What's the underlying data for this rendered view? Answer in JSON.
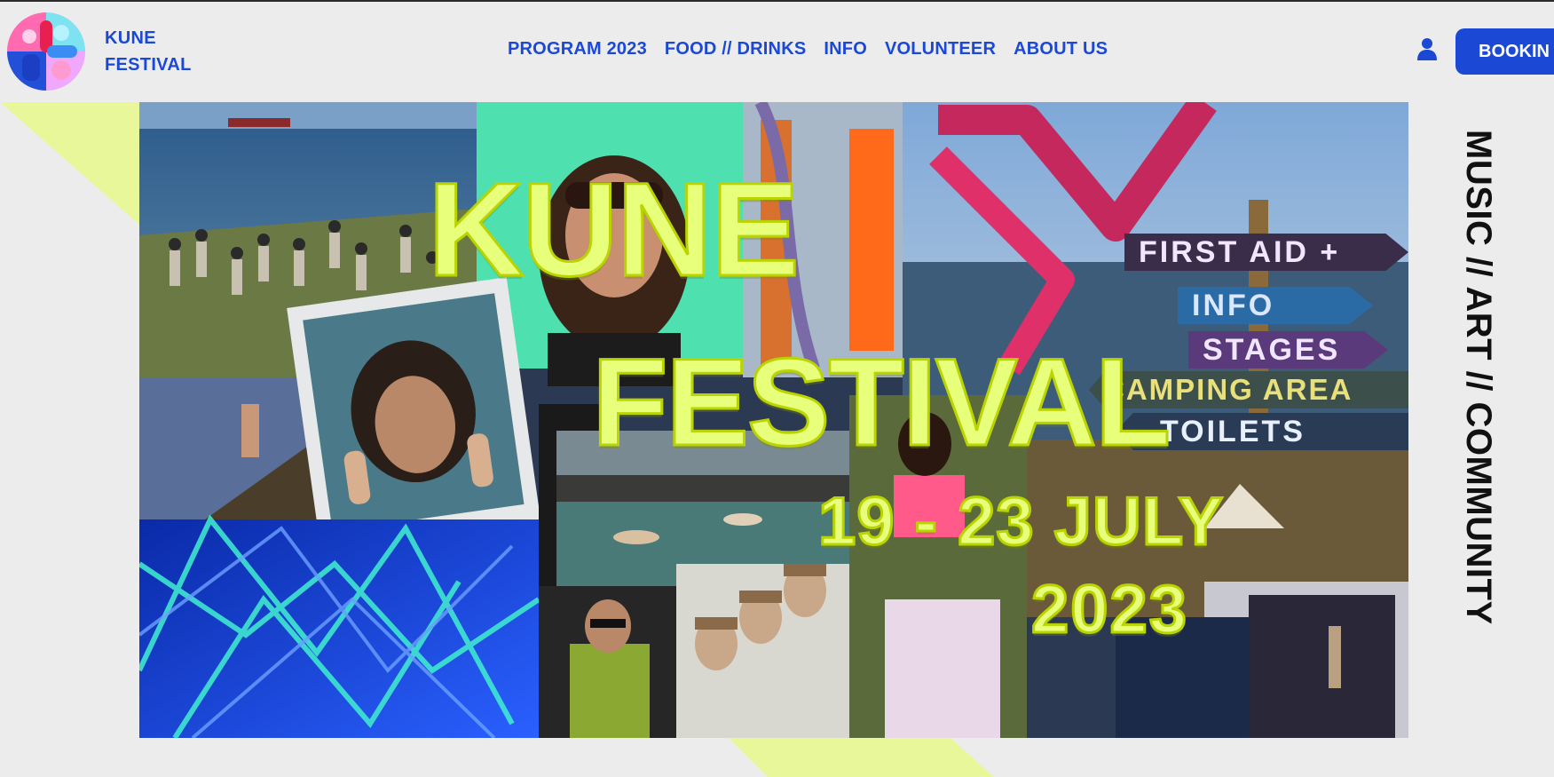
{
  "brand": {
    "line1": "KUNE",
    "line2": "FESTIVAL",
    "logo_icon": "festival-logo-icon"
  },
  "nav": [
    {
      "label": "PROGRAM 2023"
    },
    {
      "label": "FOOD // DRINKS"
    },
    {
      "label": "INFO"
    },
    {
      "label": "VOLUNTEER"
    },
    {
      "label": "ABOUT US"
    }
  ],
  "header": {
    "user_icon": "user-icon",
    "booking_label": "BOOKIN"
  },
  "hero": {
    "title_line1": "KUNE",
    "title_line2": "FESTIVAL",
    "dates": "19 - 23 JULY",
    "year": "2023",
    "signs": [
      "FIRST AID +",
      "INFO",
      "STAGES",
      "CAMPING AREA",
      "TOILETS"
    ]
  },
  "tagline": "MUSIC // ART // COMMUNITY",
  "colors": {
    "accent_blue": "#1c48d6",
    "lime": "#e7ff7a",
    "background": "#ececec"
  }
}
